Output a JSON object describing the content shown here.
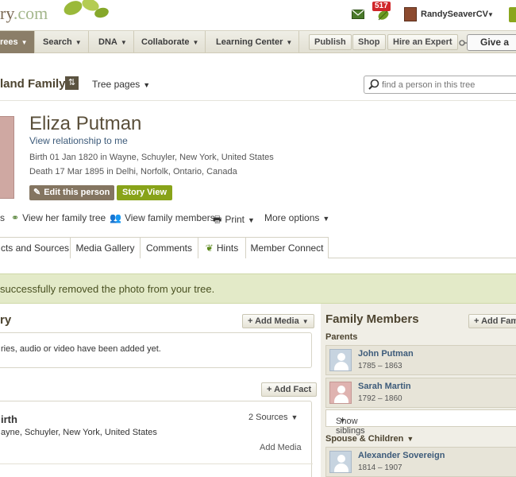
{
  "header": {
    "logo_text": "ry",
    "logo_suffix": ".com",
    "notification_count": "517",
    "username": "RandySeaverCV"
  },
  "nav": {
    "items": [
      {
        "label": "rees"
      },
      {
        "label": "Search"
      },
      {
        "label": "DNA"
      },
      {
        "label": "Collaborate"
      },
      {
        "label": "Learning Center"
      }
    ],
    "buttons": {
      "publish": "Publish",
      "shop": "Shop",
      "hire": "Hire an Expert",
      "give": "Give a"
    }
  },
  "tree": {
    "name": "land Family",
    "pages_label": "Tree pages",
    "search_placeholder": "find a person in this tree"
  },
  "person": {
    "name": "Eliza Putman",
    "view_relationship": "View relationship to me",
    "birth": "Birth 01 Jan 1820 in Wayne, Schuyler, New York, United States",
    "death": "Death 17 Mar 1895 in Delhi, Norfolk, Ontario, Canada",
    "edit_button": "Edit this person",
    "story_button": "Story View"
  },
  "actions": {
    "first": "s",
    "family_tree": "View her family tree",
    "family_members": "View family members",
    "print": "Print",
    "more": "More options"
  },
  "tabs": [
    {
      "label": "cts and Sources"
    },
    {
      "label": "Media Gallery"
    },
    {
      "label": "Comments"
    },
    {
      "label": "Hints"
    },
    {
      "label": "Member Connect"
    }
  ],
  "notice": "successfully removed the photo from your tree.",
  "media": {
    "title": "ry",
    "add_media_button": "+ Add Media",
    "empty_text": "ries, audio or video have been added yet."
  },
  "facts": {
    "add_fact_button": "+ Add Fact",
    "birth_title": "irth",
    "birth_place": "ayne, Schuyler, New York, United States",
    "sources": "2 Sources",
    "add_media_link": "Add Media"
  },
  "family": {
    "title": "Family Members",
    "add_button": "+ Add Fam",
    "parents_label": "Parents",
    "parents": [
      {
        "name": "John Putman",
        "dates": "1785 – 1863"
      },
      {
        "name": "Sarah Martin",
        "dates": "1792 – 1860"
      }
    ],
    "show_siblings": "Show siblings",
    "spouse_label": "Spouse & Children",
    "spouse": {
      "name": "Alexander Sovereign",
      "dates": "1814 – 1907"
    }
  },
  "colors": {
    "nav_active": "#8b7e68",
    "story_green": "#88a319",
    "notice_bg": "#e3eac8",
    "badge_red": "#d0262a",
    "link_blue": "#3d5b7a"
  }
}
